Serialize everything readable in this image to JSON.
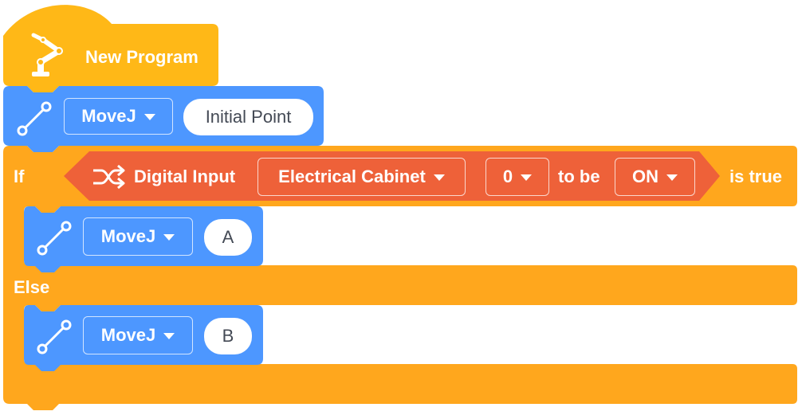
{
  "program": {
    "title": "New Program",
    "icon": "robot-arm-icon",
    "color": "#FFB817"
  },
  "initial_move": {
    "icon": "move-line-icon",
    "command": "MoveJ",
    "point": "Initial Point",
    "color": "#4D97FF"
  },
  "if_block": {
    "if_label": "If",
    "else_label": "Else",
    "color": "#FFA71D",
    "condition": {
      "icon": "shuffle-icon",
      "label": "Digital Input",
      "source": "Electrical Cabinet",
      "channel": "0",
      "to_be_label": "to be",
      "state": "ON",
      "color": "#EE6139"
    },
    "is_true_label": "is true",
    "then_move": {
      "command": "MoveJ",
      "point": "A"
    },
    "else_move": {
      "command": "MoveJ",
      "point": "B"
    }
  }
}
